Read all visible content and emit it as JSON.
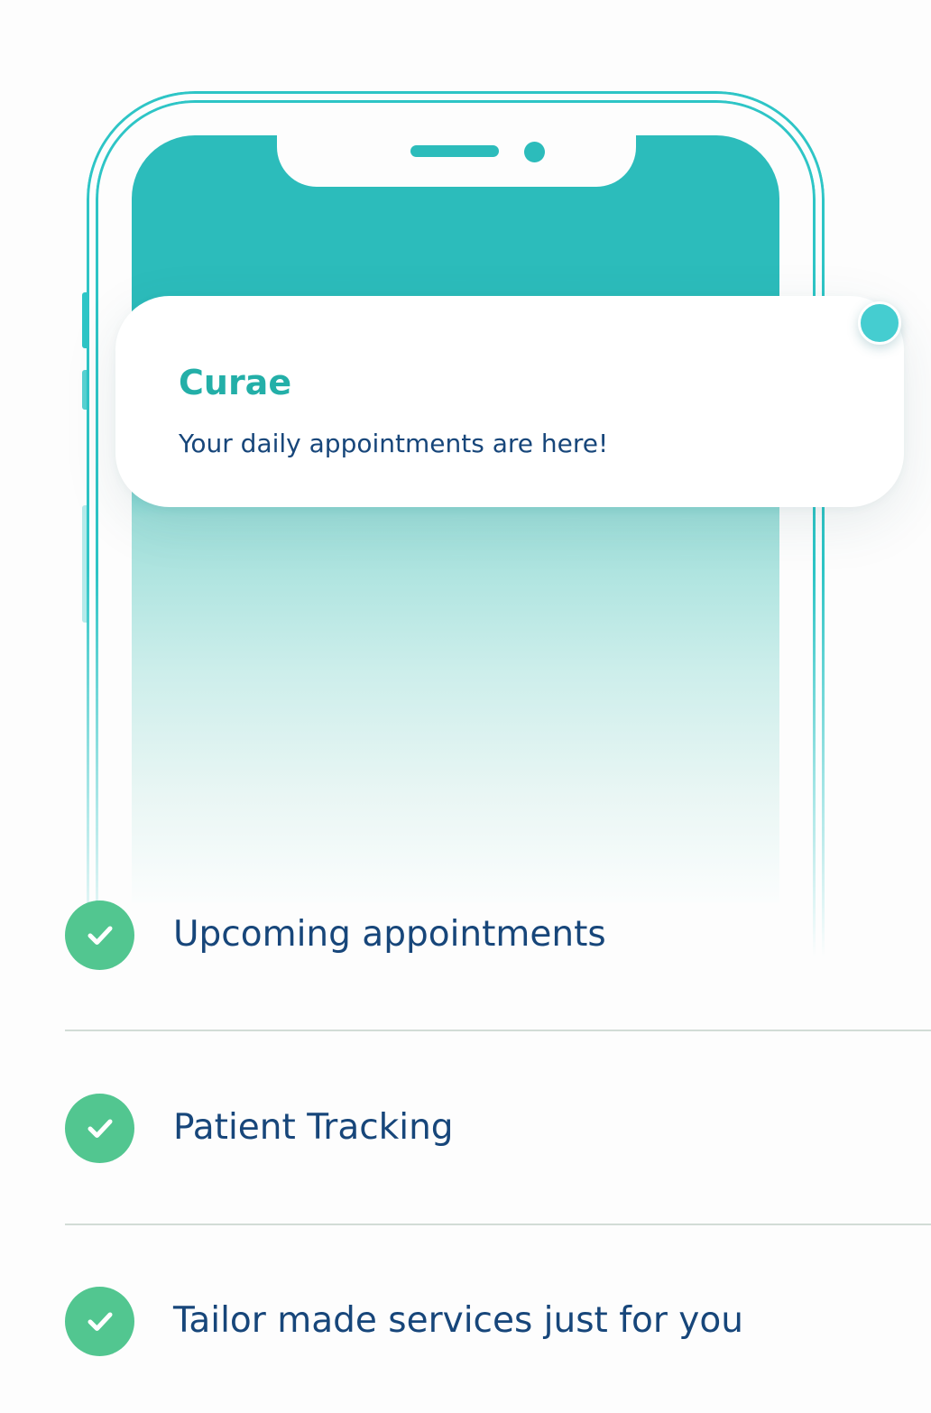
{
  "phone": {
    "frame_color": "#2ec5c6",
    "screen_color": "#2cbcbb"
  },
  "notification": {
    "title": "Curae",
    "message": "Your daily appointments are here!",
    "accent_color": "#23afa8",
    "dot_color": "#45cdd0"
  },
  "features": {
    "check_icon": "checkmark-icon",
    "check_color": "#52c690",
    "text_color": "#17467a",
    "items": [
      {
        "label": "Upcoming appointments"
      },
      {
        "label": "Patient Tracking"
      },
      {
        "label": "Tailor made services just for you"
      }
    ]
  }
}
